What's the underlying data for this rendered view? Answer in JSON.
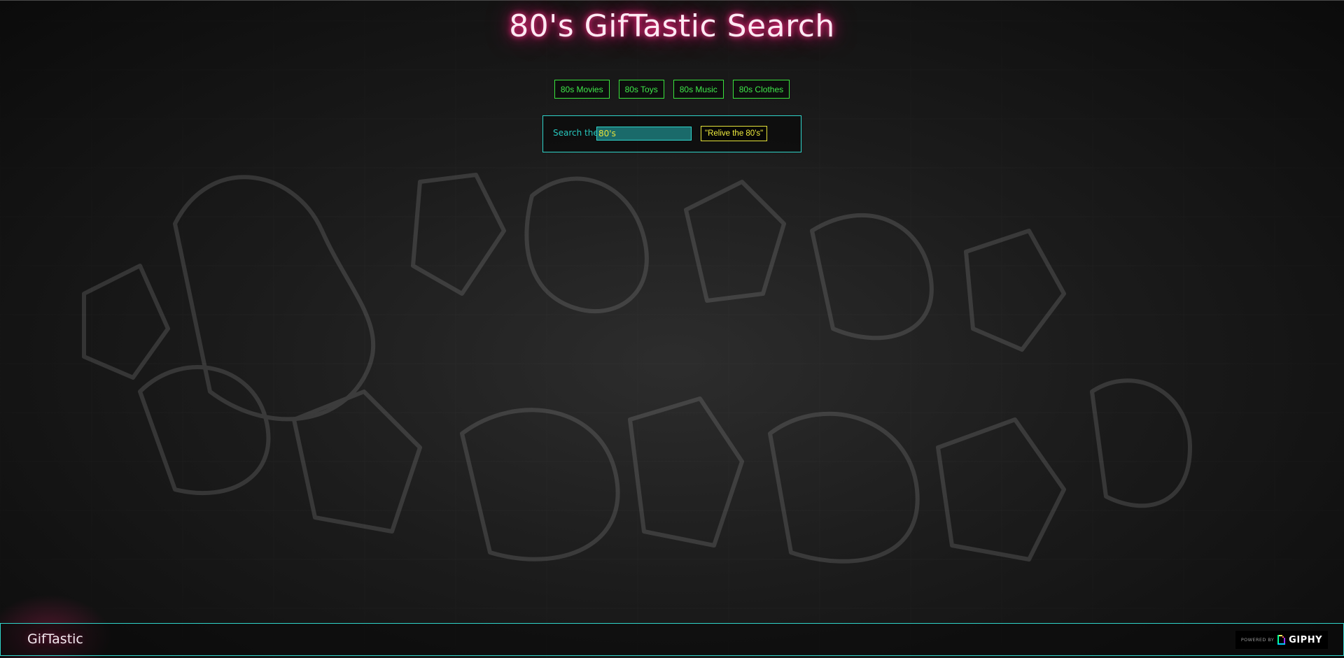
{
  "header": {
    "title": "80's GifTastic Search"
  },
  "categories": [
    {
      "label": "80s Movies"
    },
    {
      "label": "80s Toys"
    },
    {
      "label": "80s Music"
    },
    {
      "label": "80s Clothes"
    }
  ],
  "search": {
    "label": "Search the",
    "value": "80's",
    "button_label": "\"Relive the 80's\""
  },
  "footer": {
    "brand": "GifTastic",
    "powered_by": "POWERED BY",
    "giphy": "GIPHY"
  },
  "colors": {
    "title_glow": "#ff2f86",
    "category_accent": "#39e33c",
    "search_accent": "#2fd3c9",
    "button_accent": "#e6e33a"
  }
}
